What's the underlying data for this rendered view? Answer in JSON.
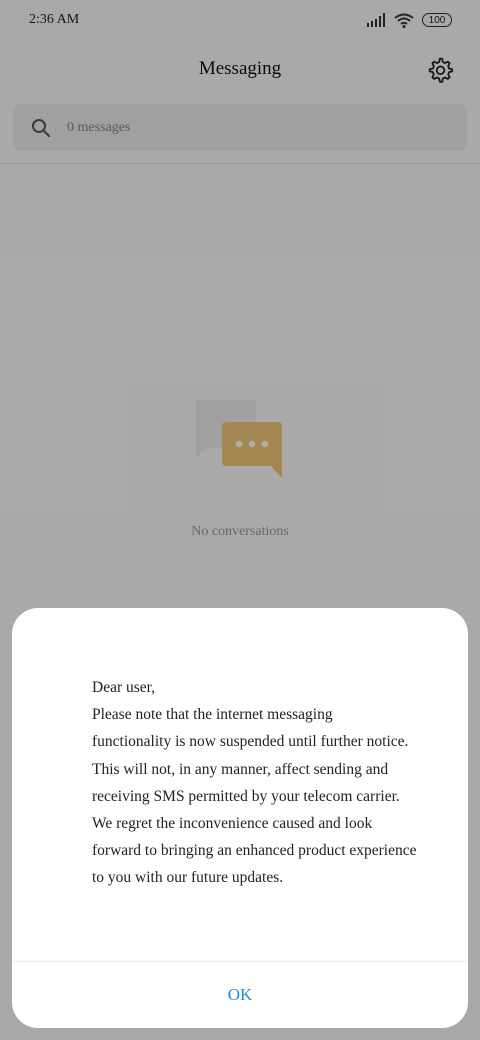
{
  "status_bar": {
    "time": "2:36 AM",
    "battery": "100",
    "icons": [
      "signal-icon",
      "wifi-icon",
      "battery-icon"
    ]
  },
  "header": {
    "title": "Messaging",
    "settings_icon": "gear-icon"
  },
  "search": {
    "placeholder": "0 messages",
    "icon": "search-icon"
  },
  "empty_state": {
    "icon": "chat-bubbles-icon",
    "text": "No conversations",
    "icon_color": "#f0c777"
  },
  "dialog": {
    "greeting": "Dear user,",
    "lines": [
      "Please note that the internet messaging",
      "functionality is now suspended until further notice.",
      "This will not, in any manner, affect sending and",
      "receiving SMS permitted by your telecom carrier.",
      "We regret the inconvenience caused and look",
      "forward to bringing an enhanced product experience",
      "to you with our future updates."
    ],
    "ok_label": "OK",
    "accent_color": "#1c8fd6"
  }
}
